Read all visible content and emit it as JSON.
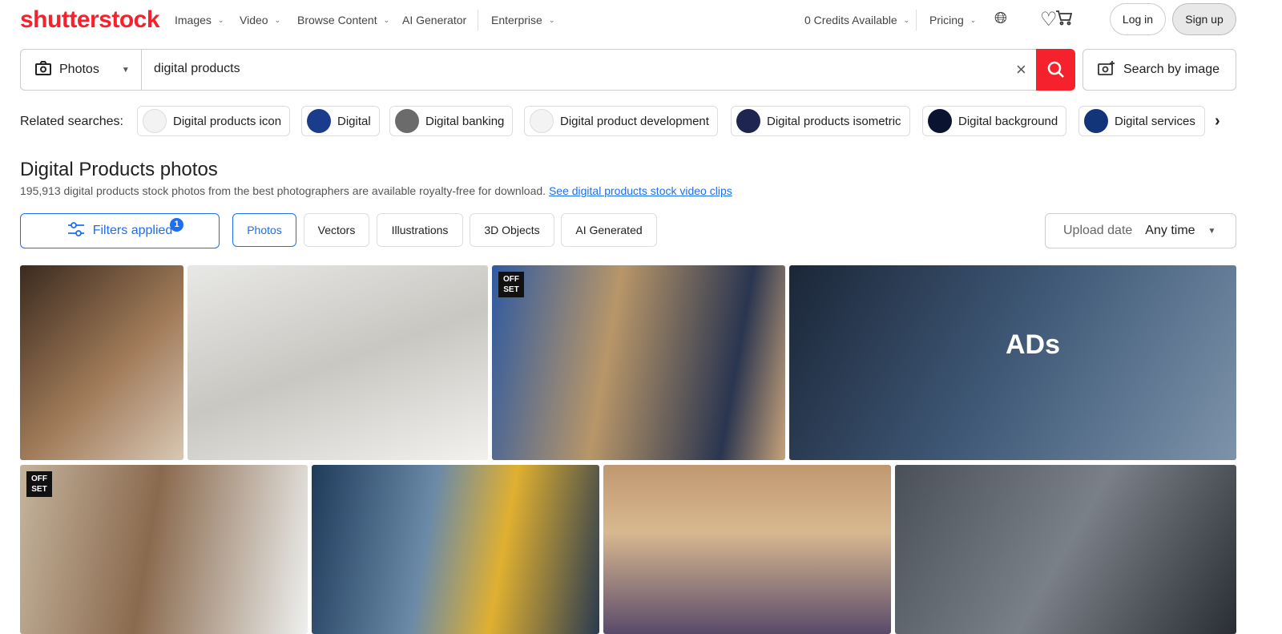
{
  "header": {
    "logo": "shutterstock",
    "nav": [
      "Images",
      "Video",
      "Browse Content",
      "AI Generator",
      "Enterprise"
    ],
    "credits": "0 Credits Available",
    "pricing": "Pricing",
    "login": "Log in",
    "signup": "Sign up"
  },
  "search": {
    "type": "Photos",
    "query": "digital products",
    "search_by_image": "Search by image"
  },
  "related": {
    "label": "Related searches:",
    "items": [
      "Digital products icon",
      "Digital",
      "Digital banking",
      "Digital product development",
      "Digital products isometric",
      "Digital background",
      "Digital services"
    ]
  },
  "page": {
    "title": "Digital Products photos",
    "subtitle": "195,913 digital products stock photos from the best photographers are available royalty-free for download.",
    "video_link": "See digital products stock video clips"
  },
  "filters": {
    "label": "Filters applied",
    "count": "1",
    "types": [
      "Photos",
      "Vectors",
      "Illustrations",
      "3D Objects",
      "AI Generated"
    ],
    "sort_label": "Upload date",
    "sort_value": "Any time"
  },
  "images": {
    "offset_badge": "OFF SET",
    "ads_text": "ADs"
  },
  "colors": {
    "brand": "#f5222d",
    "accent": "#1c6ef2"
  }
}
